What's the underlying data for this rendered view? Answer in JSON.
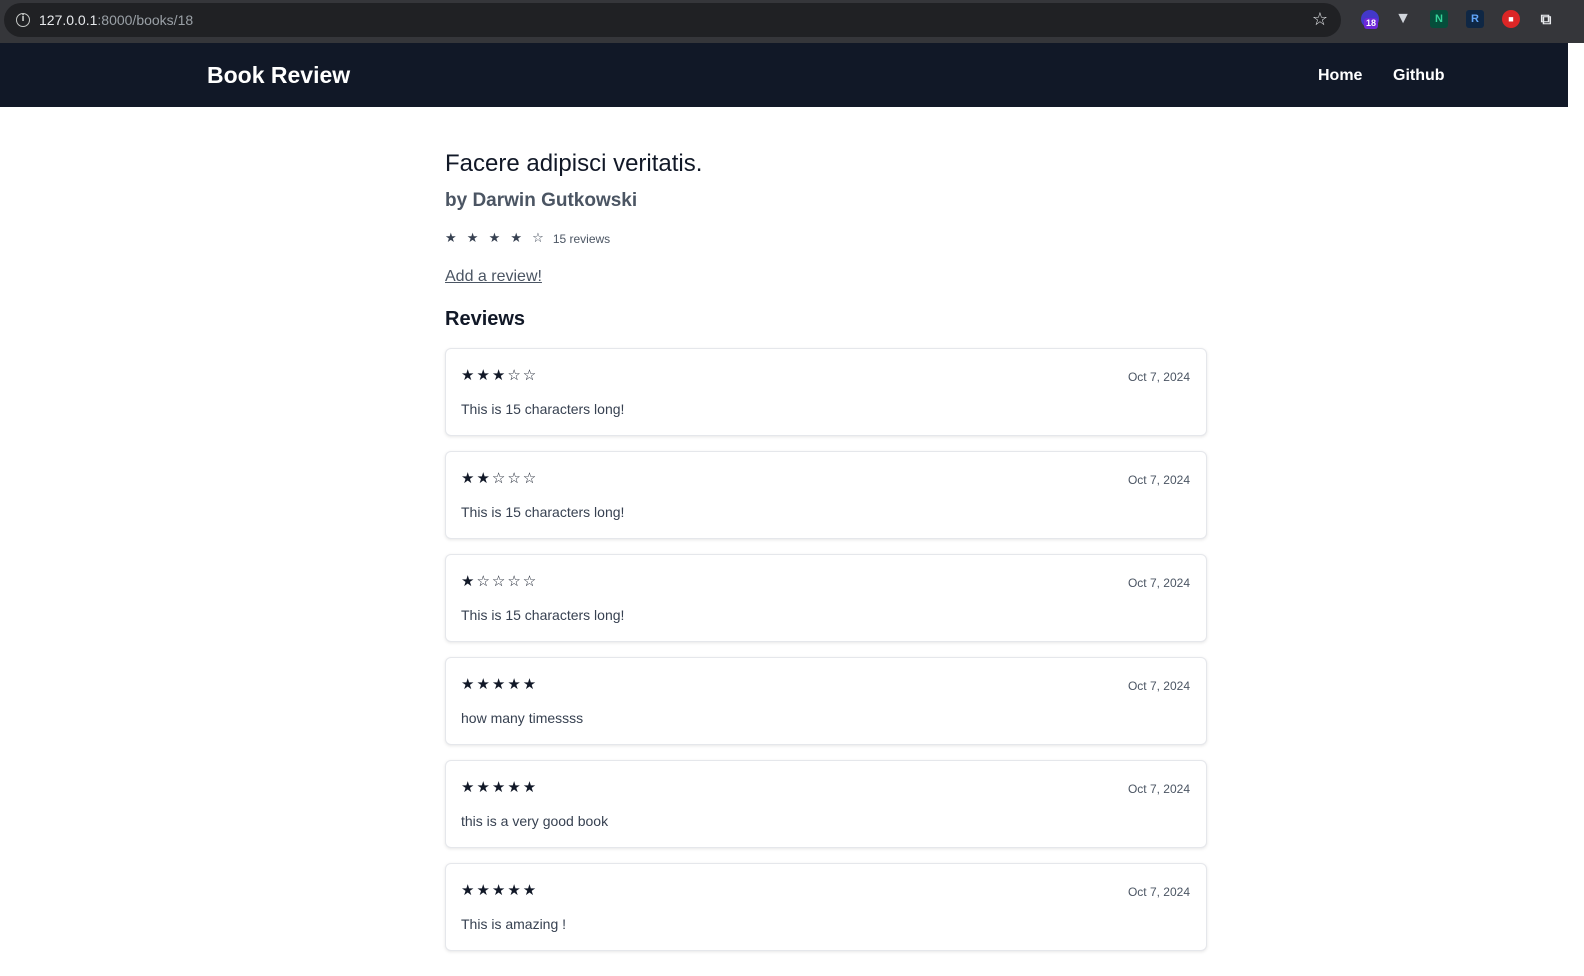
{
  "browser": {
    "url_host": "127.0.0.1",
    "url_path": ":8000/books/18",
    "extension_badge": "18",
    "extensions": [
      "purple-extension-icon",
      "vimium-icon",
      "n-extension-icon",
      "r-extension-icon",
      "lock-extension-icon",
      "puzzle-icon"
    ]
  },
  "nav": {
    "brand": "Book Review",
    "links": [
      "Home",
      "Github"
    ]
  },
  "book": {
    "title": "Facere adipisci veritatis.",
    "author": "by Darwin Gutkowski",
    "average_stars": "★ ★ ★ ★ ☆",
    "average_rating": 4,
    "review_count": "15 reviews",
    "add_review": "Add a review!"
  },
  "reviews_heading": "Reviews",
  "reviews": [
    {
      "stars": "★★★☆☆",
      "rating": 3,
      "date": "Oct 7, 2024",
      "text": "This is 15 characters long!"
    },
    {
      "stars": "★★☆☆☆",
      "rating": 2,
      "date": "Oct 7, 2024",
      "text": "This is 15 characters long!"
    },
    {
      "stars": "★☆☆☆☆",
      "rating": 1,
      "date": "Oct 7, 2024",
      "text": "This is 15 characters long!"
    },
    {
      "stars": "★★★★★",
      "rating": 5,
      "date": "Oct 7, 2024",
      "text": "how many timessss"
    },
    {
      "stars": "★★★★★",
      "rating": 5,
      "date": "Oct 7, 2024",
      "text": "this is a very good book"
    },
    {
      "stars": "★★★★★",
      "rating": 5,
      "date": "Oct 7, 2024",
      "text": "This is amazing !"
    }
  ]
}
